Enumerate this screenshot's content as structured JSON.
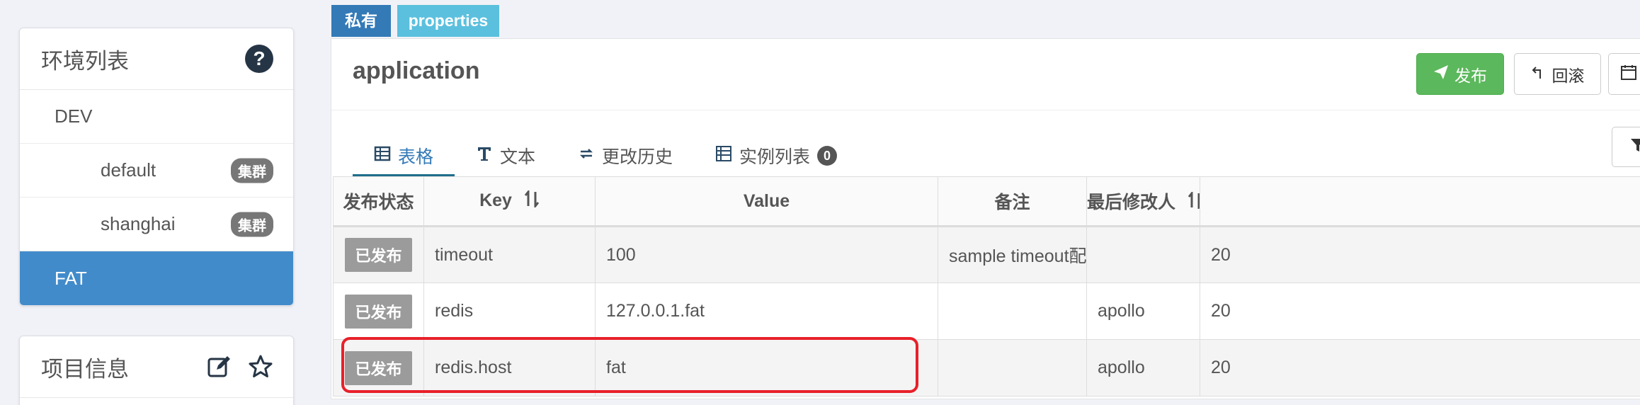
{
  "sidebar": {
    "env_panel": {
      "title": "环境列表",
      "help_icon": "question-circle-icon",
      "items": [
        {
          "label": "DEV",
          "level": 0,
          "active": false
        },
        {
          "label": "default",
          "level": 1,
          "active": false,
          "badge": "集群"
        },
        {
          "label": "shanghai",
          "level": 1,
          "active": false,
          "badge": "集群"
        },
        {
          "label": "FAT",
          "level": 0,
          "active": true
        }
      ]
    },
    "project_panel": {
      "title": "项目信息",
      "icons": [
        "edit-icon",
        "star-icon"
      ]
    }
  },
  "namespace": {
    "scope_label": "私有",
    "format_label": "properties",
    "name": "application",
    "buttons": {
      "publish": "发布",
      "rollback": "回滚"
    },
    "tabs": [
      {
        "label": "表格",
        "icon": "table-icon",
        "active": true
      },
      {
        "label": "文本",
        "icon": "text-icon",
        "active": false
      },
      {
        "label": "更改历史",
        "icon": "history-icon",
        "active": false
      },
      {
        "label": "实例列表",
        "icon": "instance-list-icon",
        "active": false,
        "count": "0"
      }
    ]
  },
  "table": {
    "columns": [
      "发布状态",
      "Key",
      "Value",
      "备注",
      "最后修改人"
    ],
    "partial_column_text": "20",
    "rows": [
      {
        "status": "已发布",
        "key": "timeout",
        "value": "100",
        "comment": "sample timeout配置",
        "modifier": ""
      },
      {
        "status": "已发布",
        "key": "redis",
        "value": "127.0.0.1.fat",
        "comment": "",
        "modifier": "apollo"
      },
      {
        "status": "已发布",
        "key": "redis.host",
        "value": "fat",
        "comment": "",
        "modifier": "apollo"
      }
    ]
  },
  "colors": {
    "active_env": "#428bca",
    "publish_button": "#5cb85c",
    "private_label": "#337ab7",
    "format_label": "#5bc0de",
    "highlight": "#e8202a"
  }
}
